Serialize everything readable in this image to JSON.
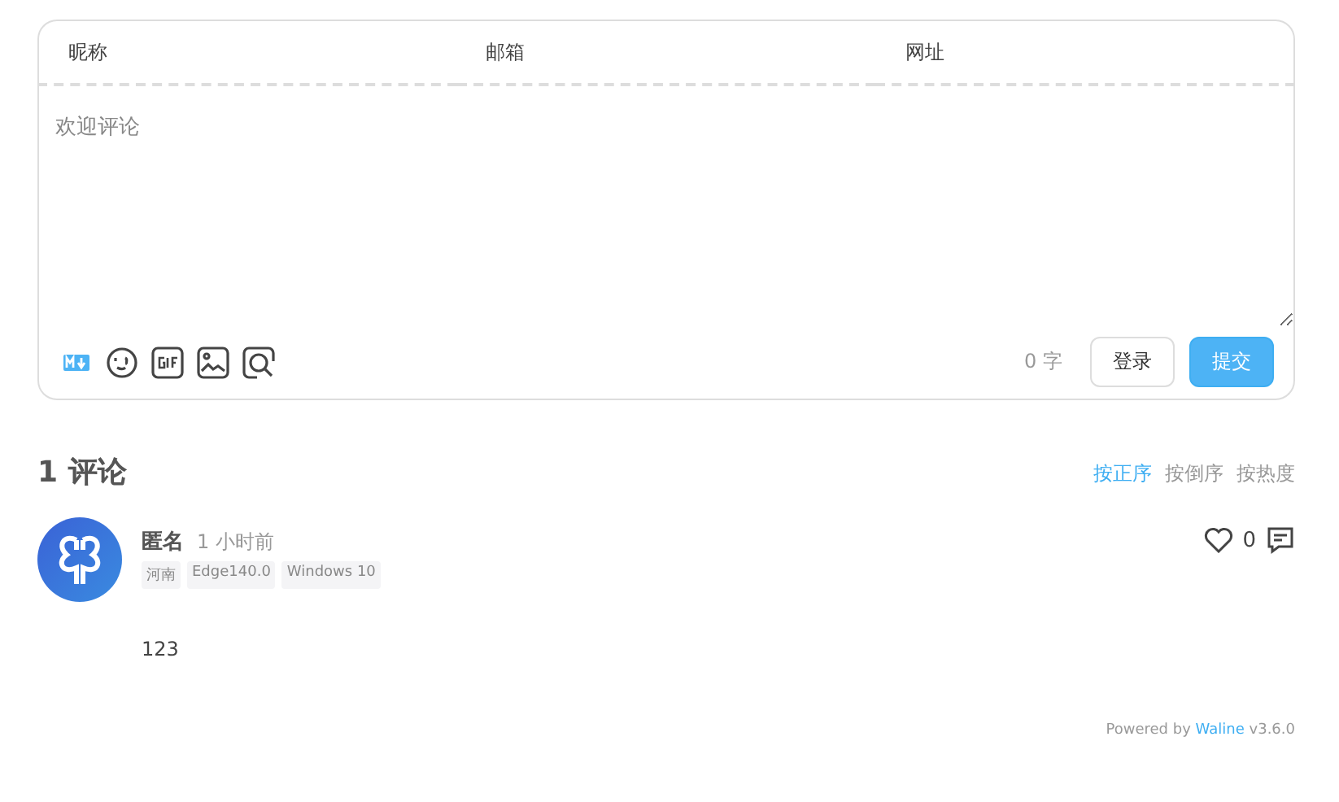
{
  "form": {
    "fields": [
      {
        "placeholder": "昵称"
      },
      {
        "placeholder": "邮箱"
      },
      {
        "placeholder": "网址"
      }
    ],
    "editor": {
      "placeholder": "欢迎评论"
    },
    "tools": [
      {
        "kind": "markdown"
      },
      {
        "kind": "emoji"
      },
      {
        "kind": "gif"
      },
      {
        "kind": "image"
      },
      {
        "kind": "preview"
      }
    ],
    "word_count": "0",
    "word_unit": "字",
    "login": "登录",
    "submit": "提交"
  },
  "comments_heading": {
    "count": "1",
    "label": "评论"
  },
  "sort": [
    {
      "label": "按正序",
      "selected": true
    },
    {
      "label": "按倒序",
      "selected": false
    },
    {
      "label": "按热度",
      "selected": false
    }
  ],
  "comments": [
    {
      "name": "匿名",
      "time": "1 小时前",
      "tags": [
        "河南",
        "Edge140.0",
        "Windows 10"
      ],
      "likes": "0",
      "text": "123"
    }
  ],
  "footer": {
    "prefix": "Powered by",
    "link": "Waline",
    "version": "v3.6.0"
  }
}
